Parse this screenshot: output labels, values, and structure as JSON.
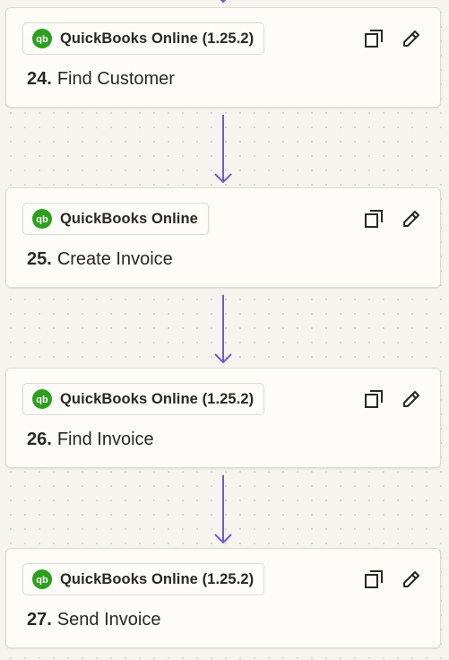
{
  "colors": {
    "connector": "#6f5bd6",
    "quickbooks_green": "#2ca01c",
    "text": "#2b2722"
  },
  "steps": [
    {
      "number": "24.",
      "title": "Find Customer",
      "app": "QuickBooks Online (1.25.2)",
      "app_icon": "quickbooks-icon",
      "actions": [
        "copy-icon",
        "edit-icon"
      ]
    },
    {
      "number": "25.",
      "title": "Create Invoice",
      "app": "QuickBooks Online",
      "app_icon": "quickbooks-icon",
      "actions": [
        "copy-icon",
        "edit-icon"
      ]
    },
    {
      "number": "26.",
      "title": "Find Invoice",
      "app": "QuickBooks Online (1.25.2)",
      "app_icon": "quickbooks-icon",
      "actions": [
        "copy-icon",
        "edit-icon"
      ]
    },
    {
      "number": "27.",
      "title": "Send Invoice",
      "app": "QuickBooks Online (1.25.2)",
      "app_icon": "quickbooks-icon",
      "actions": [
        "copy-icon",
        "edit-icon"
      ]
    }
  ]
}
